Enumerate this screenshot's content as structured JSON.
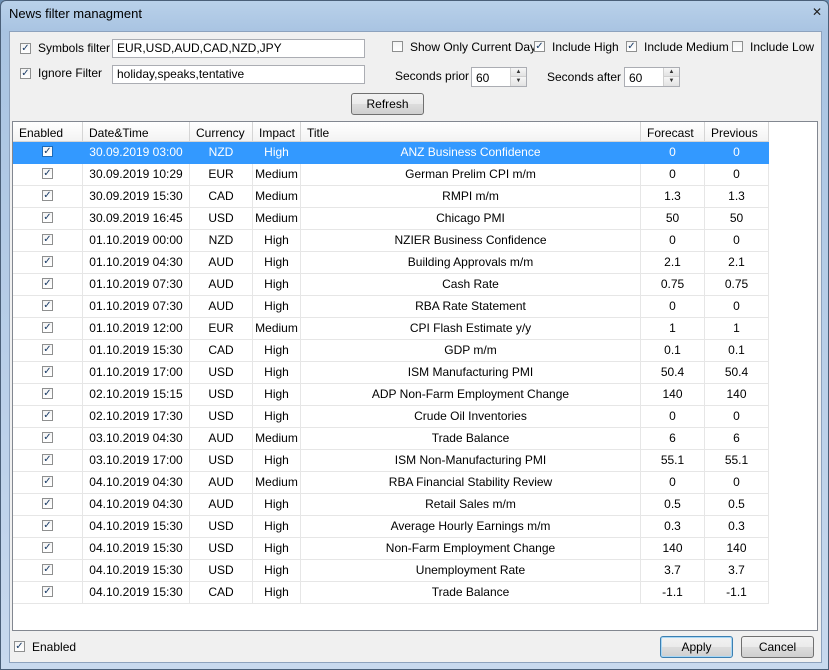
{
  "window": {
    "title": "News filter managment",
    "close_symbol": "✕"
  },
  "filters": {
    "symbols_filter": {
      "label": "Symbols filter",
      "checked": true,
      "value": "EUR,USD,AUD,CAD,NZD,JPY"
    },
    "ignore_filter": {
      "label": "Ignore Filter",
      "checked": true,
      "value": "holiday,speaks,tentative"
    },
    "show_only_current_day": {
      "label": "Show Only Current Day",
      "checked": false
    },
    "include_high": {
      "label": "Include High",
      "checked": true
    },
    "include_medium": {
      "label": "Include Medium",
      "checked": true
    },
    "include_low": {
      "label": "Include Low",
      "checked": false
    },
    "seconds_prior": {
      "label": "Seconds prior",
      "value": "60"
    },
    "seconds_after": {
      "label": "Seconds after",
      "value": "60"
    },
    "refresh_label": "Refresh"
  },
  "table": {
    "columns": [
      "Enabled",
      "Date&Time",
      "Currency",
      "Impact",
      "Title",
      "Forecast",
      "Previous"
    ],
    "rows": [
      {
        "enabled": true,
        "datetime": "30.09.2019 03:00",
        "currency": "NZD",
        "impact": "High",
        "title": "ANZ Business Confidence",
        "forecast": "0",
        "previous": "0"
      },
      {
        "enabled": true,
        "datetime": "30.09.2019 10:29",
        "currency": "EUR",
        "impact": "Medium",
        "title": "German Prelim CPI m/m",
        "forecast": "0",
        "previous": "0"
      },
      {
        "enabled": true,
        "datetime": "30.09.2019 15:30",
        "currency": "CAD",
        "impact": "Medium",
        "title": "RMPI m/m",
        "forecast": "1.3",
        "previous": "1.3"
      },
      {
        "enabled": true,
        "datetime": "30.09.2019 16:45",
        "currency": "USD",
        "impact": "Medium",
        "title": "Chicago PMI",
        "forecast": "50",
        "previous": "50"
      },
      {
        "enabled": true,
        "datetime": "01.10.2019 00:00",
        "currency": "NZD",
        "impact": "High",
        "title": "NZIER Business Confidence",
        "forecast": "0",
        "previous": "0"
      },
      {
        "enabled": true,
        "datetime": "01.10.2019 04:30",
        "currency": "AUD",
        "impact": "High",
        "title": "Building Approvals m/m",
        "forecast": "2.1",
        "previous": "2.1"
      },
      {
        "enabled": true,
        "datetime": "01.10.2019 07:30",
        "currency": "AUD",
        "impact": "High",
        "title": "Cash Rate",
        "forecast": "0.75",
        "previous": "0.75"
      },
      {
        "enabled": true,
        "datetime": "01.10.2019 07:30",
        "currency": "AUD",
        "impact": "High",
        "title": "RBA Rate Statement",
        "forecast": "0",
        "previous": "0"
      },
      {
        "enabled": true,
        "datetime": "01.10.2019 12:00",
        "currency": "EUR",
        "impact": "Medium",
        "title": "CPI Flash Estimate y/y",
        "forecast": "1",
        "previous": "1"
      },
      {
        "enabled": true,
        "datetime": "01.10.2019 15:30",
        "currency": "CAD",
        "impact": "High",
        "title": "GDP m/m",
        "forecast": "0.1",
        "previous": "0.1"
      },
      {
        "enabled": true,
        "datetime": "01.10.2019 17:00",
        "currency": "USD",
        "impact": "High",
        "title": "ISM Manufacturing PMI",
        "forecast": "50.4",
        "previous": "50.4"
      },
      {
        "enabled": true,
        "datetime": "02.10.2019 15:15",
        "currency": "USD",
        "impact": "High",
        "title": "ADP Non-Farm Employment Change",
        "forecast": "140",
        "previous": "140"
      },
      {
        "enabled": true,
        "datetime": "02.10.2019 17:30",
        "currency": "USD",
        "impact": "High",
        "title": "Crude Oil Inventories",
        "forecast": "0",
        "previous": "0"
      },
      {
        "enabled": true,
        "datetime": "03.10.2019 04:30",
        "currency": "AUD",
        "impact": "Medium",
        "title": "Trade Balance",
        "forecast": "6",
        "previous": "6"
      },
      {
        "enabled": true,
        "datetime": "03.10.2019 17:00",
        "currency": "USD",
        "impact": "High",
        "title": "ISM Non-Manufacturing PMI",
        "forecast": "55.1",
        "previous": "55.1"
      },
      {
        "enabled": true,
        "datetime": "04.10.2019 04:30",
        "currency": "AUD",
        "impact": "Medium",
        "title": "RBA Financial Stability Review",
        "forecast": "0",
        "previous": "0"
      },
      {
        "enabled": true,
        "datetime": "04.10.2019 04:30",
        "currency": "AUD",
        "impact": "High",
        "title": "Retail Sales m/m",
        "forecast": "0.5",
        "previous": "0.5"
      },
      {
        "enabled": true,
        "datetime": "04.10.2019 15:30",
        "currency": "USD",
        "impact": "High",
        "title": "Average Hourly Earnings m/m",
        "forecast": "0.3",
        "previous": "0.3"
      },
      {
        "enabled": true,
        "datetime": "04.10.2019 15:30",
        "currency": "USD",
        "impact": "High",
        "title": "Non-Farm Employment Change",
        "forecast": "140",
        "previous": "140"
      },
      {
        "enabled": true,
        "datetime": "04.10.2019 15:30",
        "currency": "USD",
        "impact": "High",
        "title": "Unemployment Rate",
        "forecast": "3.7",
        "previous": "3.7"
      },
      {
        "enabled": true,
        "datetime": "04.10.2019 15:30",
        "currency": "CAD",
        "impact": "High",
        "title": "Trade Balance",
        "forecast": "-1.1",
        "previous": "-1.1"
      }
    ],
    "selected_row": 0
  },
  "footer": {
    "enabled": {
      "label": "Enabled",
      "checked": true
    },
    "apply_label": "Apply",
    "cancel_label": "Cancel"
  },
  "colors": {
    "selection": "#3399ff",
    "check_mark": "#1a3b66"
  }
}
